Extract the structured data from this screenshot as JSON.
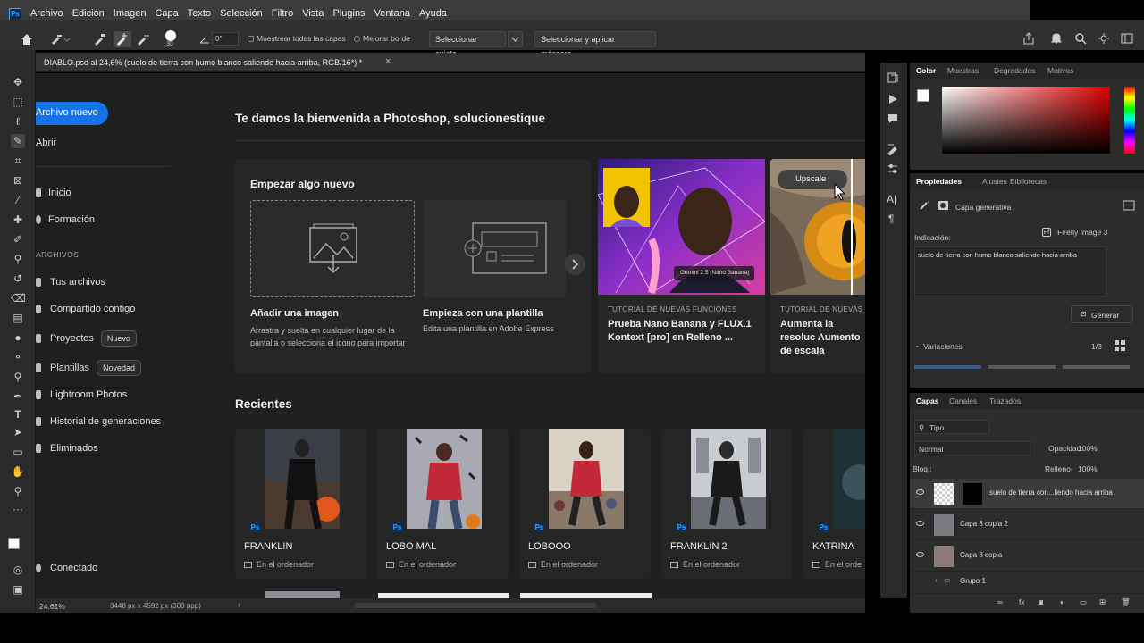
{
  "menubar": {
    "app_icon": "Ps",
    "items": [
      "Archivo",
      "Edición",
      "Imagen",
      "Capa",
      "Texto",
      "Selección",
      "Filtro",
      "Vista",
      "Plugins",
      "Ventana",
      "Ayuda"
    ]
  },
  "options": {
    "brush_size": "30",
    "angle": "0°",
    "sample_all_layers": "Muestrear todas las capas",
    "enhance_edge": "Mejorar borde",
    "select_subject": "Seleccionar sujeto",
    "select_and_mask": "Seleccionar y aplicar máscara..."
  },
  "document": {
    "tab_title": "DIABLO.psd al 24,6% (suelo de tierra con humo blanco saliendo hacia arriba, RGB/16*) *",
    "close": "×"
  },
  "home": {
    "new_file_button": "Archivo nuevo",
    "open": "Abrir",
    "nav": [
      {
        "label": "Inicio"
      },
      {
        "label": "Formación"
      }
    ],
    "files_heading": "ARCHIVOS",
    "files_nav": [
      {
        "label": "Tus archivos",
        "badge": ""
      },
      {
        "label": "Compartido contigo",
        "badge": ""
      },
      {
        "label": "Proyectos",
        "badge": "Nuevo"
      },
      {
        "label": "Plantillas",
        "badge": "Novedad"
      },
      {
        "label": "Lightroom Photos",
        "badge": ""
      },
      {
        "label": "Historial de generaciones",
        "badge": ""
      },
      {
        "label": "Eliminados",
        "badge": ""
      }
    ],
    "connected": "Conectado",
    "welcome": "Te damos la bienvenida a Photoshop, solucionestique",
    "start_new": "Empezar algo nuevo",
    "add_image_title": "Añadir una imagen",
    "add_image_desc": "Arrastra y suelta en cualquier lugar de la pantalla o selecciona el icono para importar",
    "template_title": "Empieza con una plantilla",
    "template_desc": "Edita una plantilla en Adobe Express",
    "tutorial1_tag": "TUTORIAL DE NUEVAS FUNCIONES",
    "tutorial1_title": "Prueba Nano Banana y FLUX.1 Kontext [pro] en Relleno ...",
    "tutorial1_badge": "Gemini 2.5 (Nano Banana)",
    "tutorial2_tag": "TUTORIAL DE NUEVAS",
    "tutorial2_title": "Aumenta la resoluc Aumento de escala",
    "upscale": "Upscale",
    "recents_heading": "Recientes",
    "recents": [
      {
        "name": "FRANKLIN",
        "location": "En el ordenador"
      },
      {
        "name": "LOBO MAL",
        "location": "En el ordenador"
      },
      {
        "name": "LOBOOO",
        "location": "En el ordenador"
      },
      {
        "name": "FRANKLIN 2",
        "location": "En el ordenador"
      },
      {
        "name": "KATRINA",
        "location": "En el orde"
      }
    ]
  },
  "status": {
    "zoom": "24.61%",
    "dimensions": "3448 px x 4592 px (300 ppp)"
  },
  "color_panel": {
    "tabs": [
      "Color",
      "Muestras",
      "Degradados",
      "Motivos"
    ]
  },
  "properties_panel": {
    "tabs": [
      "Propiedades",
      "Ajustes",
      "Bibliotecas"
    ],
    "layer_type": "Capa generativa",
    "prompt_label": "Indicación:",
    "model": "Firefly Image 3",
    "prompt": "suelo de tierra con humo blanco saliendo hacia arriba",
    "generate": "Generar",
    "variations": "Variaciones",
    "variation_count": "1/3"
  },
  "layers_panel": {
    "tabs": [
      "Capas",
      "Canales",
      "Trazados"
    ],
    "filter": "Tipo",
    "blend_mode": "Normal",
    "opacity_label": "Opacidad:",
    "opacity": "100%",
    "lock_label": "Bloq.:",
    "fill_label": "Relleno:",
    "fill": "100%",
    "layers": [
      {
        "name": "suelo de tierra con...liendo hacia arriba"
      },
      {
        "name": "Capa 3 copia 2"
      },
      {
        "name": "Capa 3 copia"
      },
      {
        "name": "Grupo 1"
      }
    ]
  },
  "colors": {
    "accent": "#1473e6",
    "ps_blue": "#31a8ff"
  }
}
